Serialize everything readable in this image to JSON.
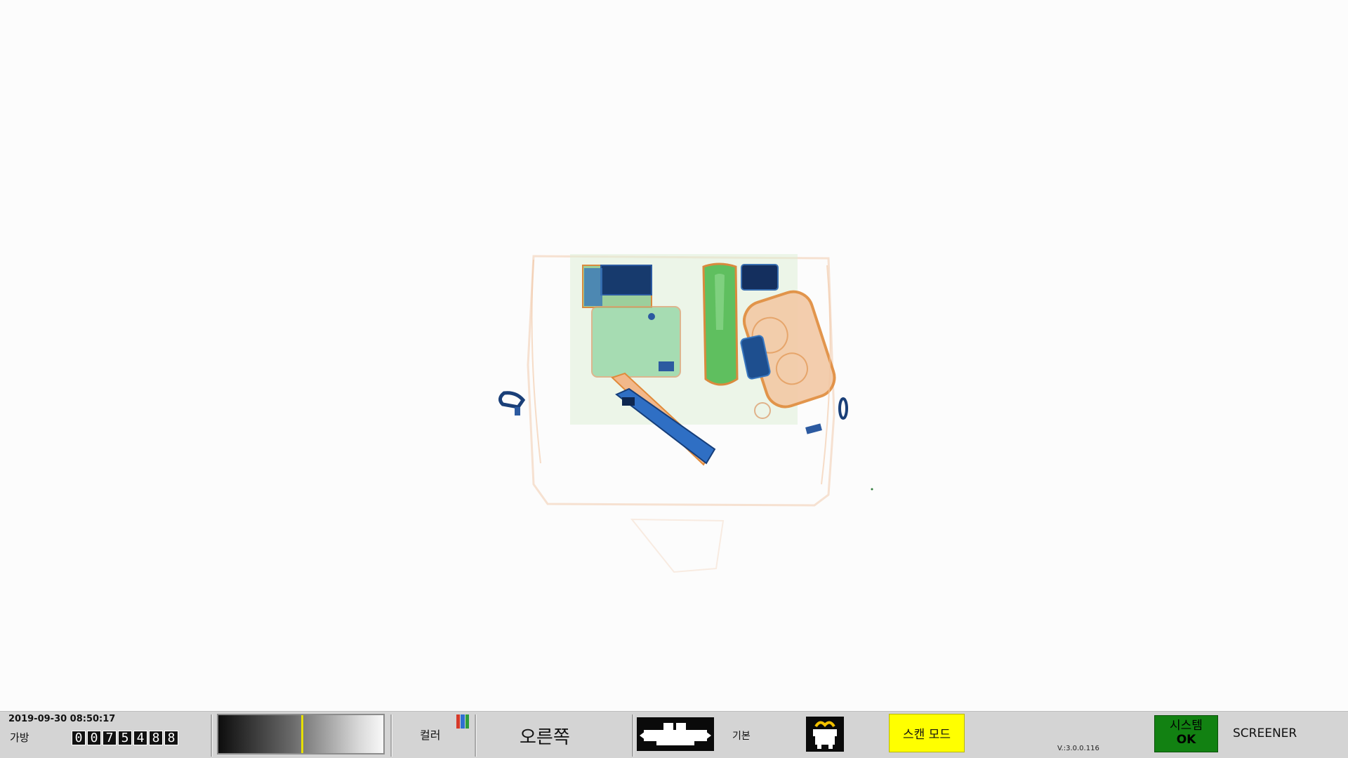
{
  "status_bar": {
    "datetime": "2019-09-30 08:50:17",
    "bag_label": "가방",
    "bag_count_digits": [
      "0",
      "0",
      "7",
      "5",
      "4",
      "8",
      "8"
    ],
    "color_label": "컬러",
    "direction_label": "오른쪽",
    "base_label": "기본",
    "scan_mode_label": "스캔 모드",
    "version": "V.:3.0.0.116",
    "system_line1": "시스템",
    "system_line2": "OK",
    "user_label": "SCREENER"
  },
  "icons": {
    "conveyor": "conveyor-belt-icon",
    "operator": "operator-bag-icon",
    "color_mode": "color-bars-icon"
  },
  "colors": {
    "accent_yellow": "#ffff00",
    "system_ok_green": "#128112",
    "color_bars": [
      "#d63a2a",
      "#2f6fd1",
      "#2f9e3c"
    ]
  }
}
